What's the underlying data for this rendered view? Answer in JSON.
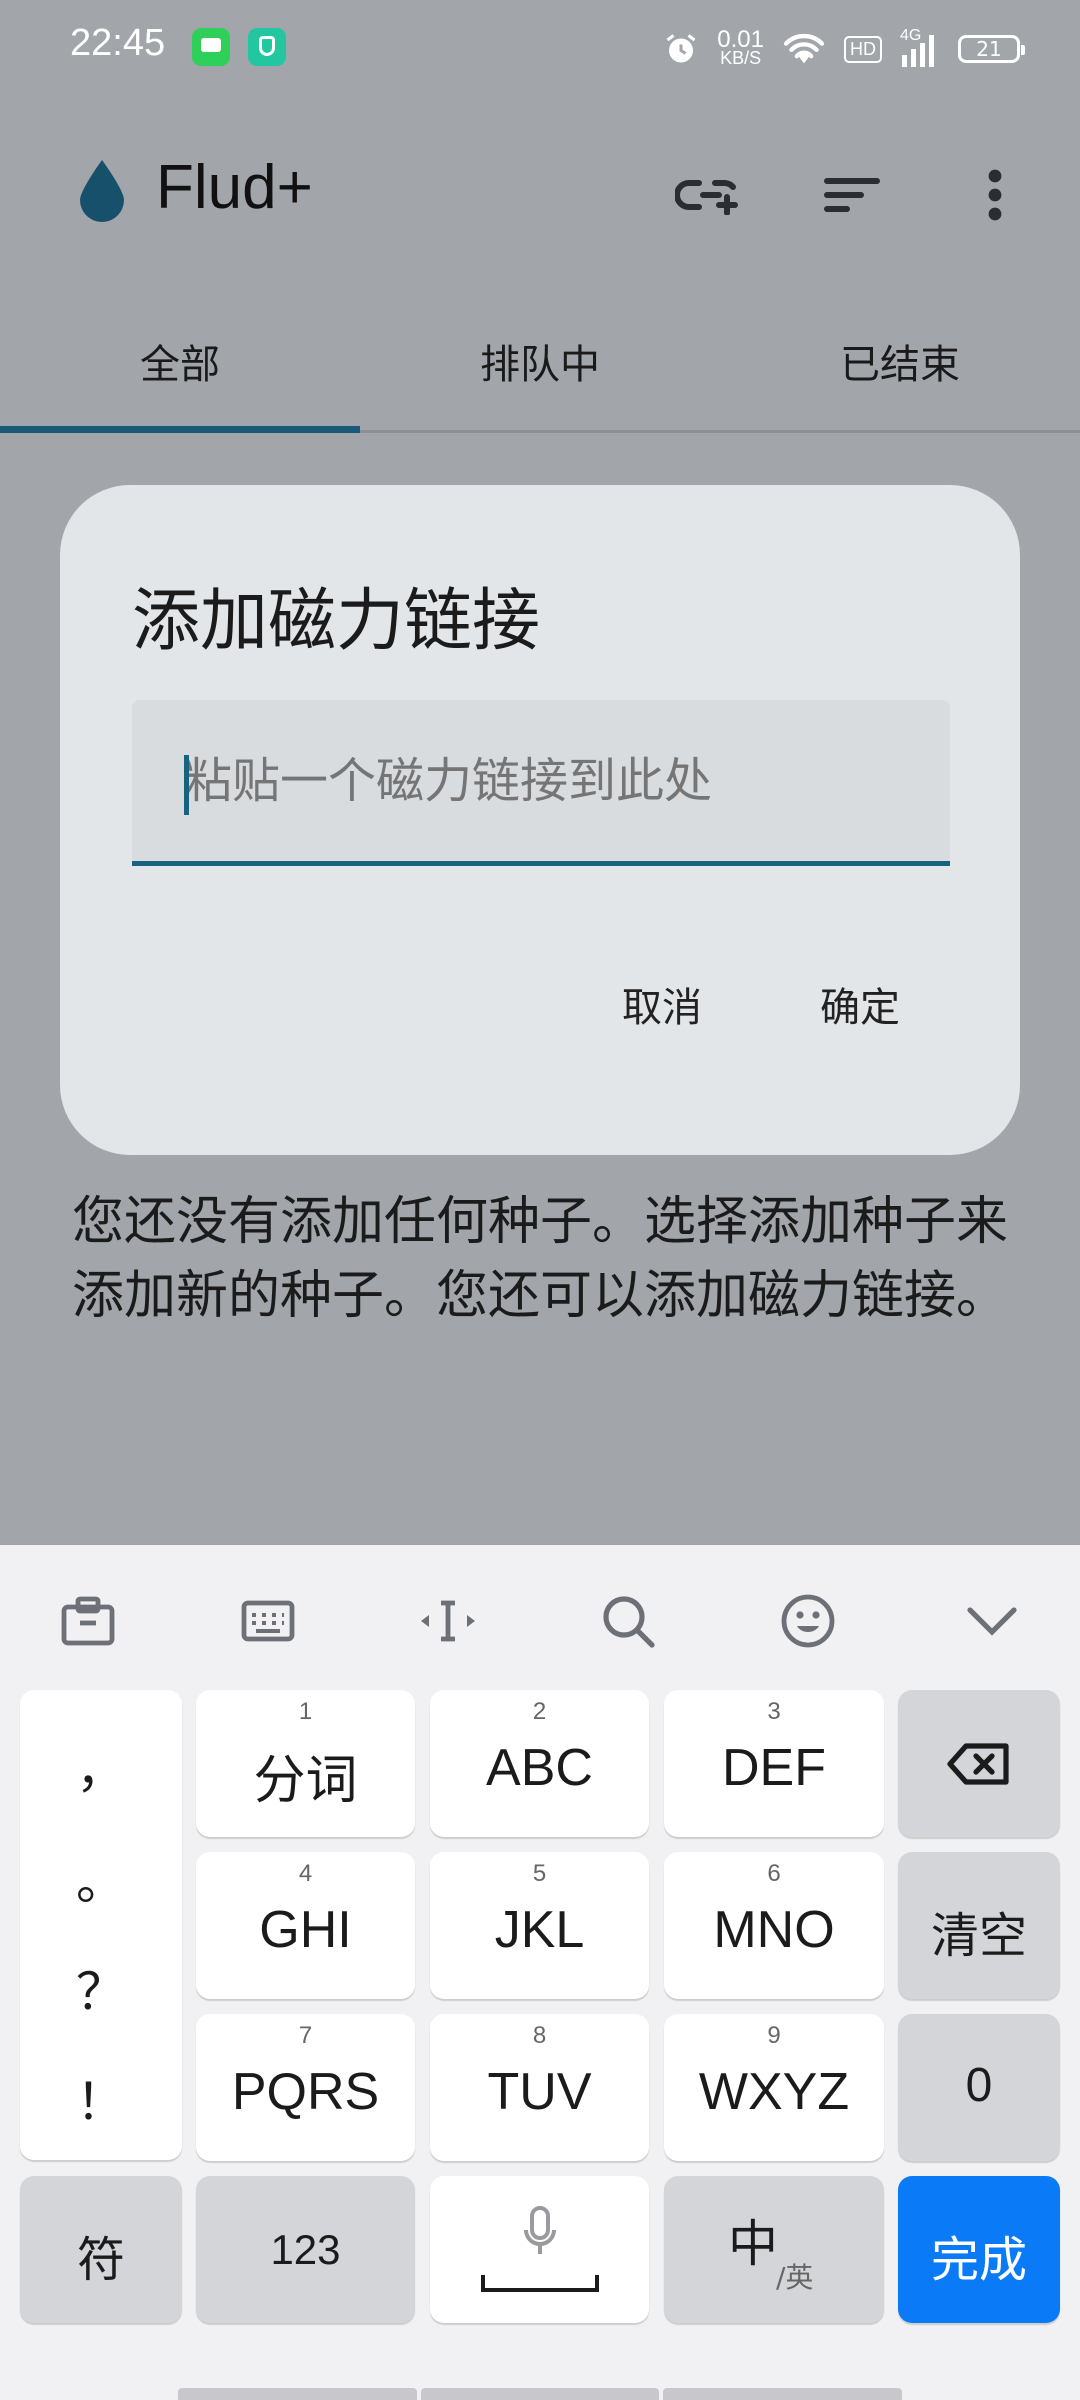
{
  "status": {
    "time": "22:45",
    "speed_value": "0.01",
    "speed_unit": "KB/S",
    "hd": "HD",
    "network": "4G",
    "battery": "21"
  },
  "app": {
    "title": "Flud+"
  },
  "tabs": [
    {
      "label": "全部"
    },
    {
      "label": "排队中"
    },
    {
      "label": "已结束"
    }
  ],
  "empty_message": "您还没有添加任何种子。选择添加种子来添加新的种子。您还可以添加磁力链接。",
  "dialog": {
    "title": "添加磁力链接",
    "input_placeholder": "粘贴一个磁力链接到此处",
    "input_value": "",
    "cancel_label": "取消",
    "ok_label": "确定"
  },
  "keyboard": {
    "punctuation": [
      "，",
      "。",
      "？",
      "！"
    ],
    "rows": [
      [
        {
          "num": "1",
          "label": "分词"
        },
        {
          "num": "2",
          "label": "ABC"
        },
        {
          "num": "3",
          "label": "DEF"
        }
      ],
      [
        {
          "num": "4",
          "label": "GHI"
        },
        {
          "num": "5",
          "label": "JKL"
        },
        {
          "num": "6",
          "label": "MNO"
        }
      ],
      [
        {
          "num": "7",
          "label": "PQRS"
        },
        {
          "num": "8",
          "label": "TUV"
        },
        {
          "num": "9",
          "label": "WXYZ"
        }
      ]
    ],
    "clear_label": "清空",
    "zero_label": "0",
    "symbol_label": "符",
    "num_label": "123",
    "lang_main": "中",
    "lang_sub": "/英",
    "done_label": "完成"
  },
  "colors": {
    "accent": "#17627f",
    "done_blue": "#0a7af6"
  }
}
